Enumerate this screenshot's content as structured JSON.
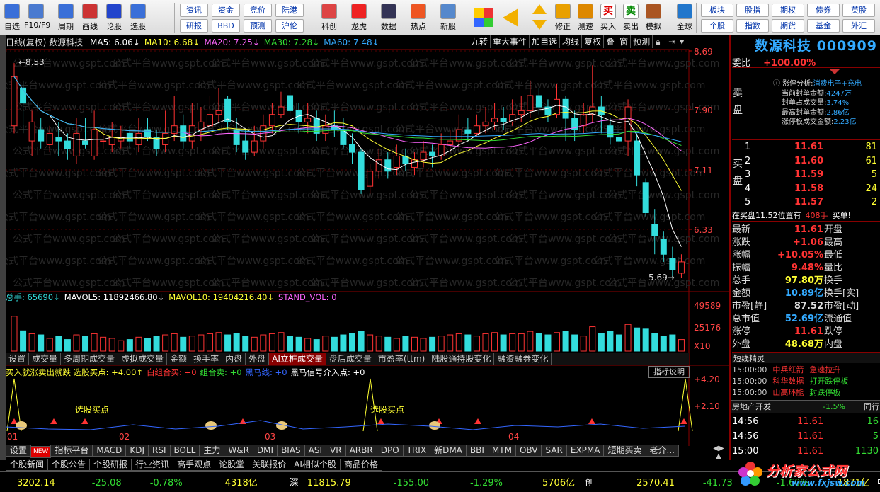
{
  "toolbar": {
    "buttons": [
      {
        "label": "自选",
        "icon": "star-grid-icon"
      },
      {
        "label": "F10/F9",
        "icon": "document-icon"
      },
      {
        "label": "周期",
        "icon": "clock-icon"
      },
      {
        "label": "画线",
        "icon": "pencil-icon"
      },
      {
        "label": "论股",
        "icon": "chat-icon"
      },
      {
        "label": "选股",
        "icon": "magnifier-chart-icon"
      }
    ],
    "grid": [
      "资讯",
      "资金",
      "竞价",
      "陆港",
      "研报",
      "BBD",
      "预测",
      "沪伦"
    ],
    "buttons2": [
      {
        "label": "科创",
        "icon": "chart-icon"
      },
      {
        "label": "龙虎",
        "icon": "dragon-icon"
      },
      {
        "label": "数据",
        "icon": "pe-icon"
      },
      {
        "label": "热点",
        "icon": "flame-icon"
      },
      {
        "label": "新股",
        "icon": "ipo-icon"
      }
    ],
    "buttons3": [
      {
        "label": "修正",
        "icon": "undo-icon"
      },
      {
        "label": "测速",
        "icon": "stopwatch-icon"
      },
      {
        "label": "买入",
        "icon": "buy-icon",
        "glyph": "买"
      },
      {
        "label": "卖出",
        "icon": "sell-icon",
        "glyph": "卖"
      },
      {
        "label": "模拟",
        "icon": "hammer-icon"
      },
      {
        "label": "全球",
        "icon": "globe-icon"
      }
    ],
    "grid2": [
      "板块",
      "股指",
      "期权",
      "债券",
      "英股",
      "个股",
      "指数",
      "期货",
      "基金",
      "外汇"
    ]
  },
  "chart": {
    "title_line": "日线(复权) 数源科技",
    "ma": [
      {
        "label": "MA5: 6.06↓",
        "color": "#ffffff"
      },
      {
        "label": "MA10: 6.68↓",
        "color": "#ffff33"
      },
      {
        "label": "MA20: 7.25↓",
        "color": "#ff66ff"
      },
      {
        "label": "MA30: 7.28↓",
        "color": "#33dd33"
      },
      {
        "label": "MA60: 7.48↓",
        "color": "#33aaff"
      }
    ],
    "top_buttons": [
      "九转",
      "重大事件",
      "加自选",
      "均线",
      "复权",
      "叠",
      "窗",
      "预测"
    ],
    "price_ticks": [
      "8.69",
      "7.90",
      "7.11",
      "6.33"
    ],
    "high_label": "8.53",
    "low_label": "5.69",
    "watermark": "公式平台www.gspt.com",
    "vol_line": {
      "parts": [
        {
          "t": "总手: 65690↓",
          "c": "#33dddd"
        },
        {
          "t": "MAVOL5: 11892466.80↓",
          "c": "#ffffff"
        },
        {
          "t": "MAVOL10: 19404216.40↓",
          "c": "#ffff33"
        },
        {
          "t": "STAND_VOL: 0",
          "c": "#ff66ff"
        }
      ]
    },
    "vol_ticks": [
      "49589",
      "25176",
      "X10"
    ],
    "vol_tabs": [
      "设置",
      "成交量",
      "多周期成交量",
      "虚拟成交量",
      "金额",
      "换手率",
      "内盘",
      "外盘",
      "AI立桩成交量",
      "盘后成交量",
      "市盈率(ttm)",
      "陆股通持股变化",
      "融资融券变化"
    ],
    "vol_tab_active": "AI立桩成交量",
    "ind_line": {
      "parts": [
        {
          "t": "买入就涨卖出就跌 选股买点: +4.00↑",
          "c": "#ffff33"
        },
        {
          "t": "白组合买: +0",
          "c": "#ff3333"
        },
        {
          "t": "组合卖: +0",
          "c": "#33dd33"
        },
        {
          "t": "黑马线: +0",
          "c": "#3366ff"
        },
        {
          "t": "黑马信号介入点: +0",
          "c": "#ffffff"
        }
      ]
    },
    "ind_button": "指标说明",
    "ind_ticks": [
      "+4.20",
      "+2.10"
    ],
    "ind_annots": [
      "选股买点",
      "选股买点"
    ],
    "date_labels": [
      "01",
      "02",
      "03",
      "04"
    ],
    "bottom_tabs": [
      "设置",
      "NEW",
      "指标平台",
      "MACD",
      "KDJ",
      "RSI",
      "BOLL",
      "主力",
      "W&R",
      "DMI",
      "BIAS",
      "ASI",
      "VR",
      "ARBR",
      "DPO",
      "TRIX",
      "新DMA",
      "BBI",
      "MTM",
      "OBV",
      "SAR",
      "EXPMA",
      "短期买卖",
      "老介..."
    ],
    "news_tabs": [
      "个股新闻",
      "个股公告",
      "个股研报",
      "行业资讯",
      "高手观点",
      "论股堂",
      "关联报价",
      "AI相似个股",
      "商品价格"
    ]
  },
  "quote": {
    "name": "数源科技",
    "code": "000909",
    "weibi_label": "委比",
    "weibi": "+100.00%",
    "sell_label": "卖盘",
    "buy_label": "买盘",
    "limit_analysis": {
      "title": "涨停分析:",
      "tag": "消费电子+充电",
      "rows": [
        [
          "当前封单金额:",
          "4247万"
        ],
        [
          "封单占成交量:",
          "3.74%"
        ],
        [
          "最高封单金额:",
          "2.86亿"
        ],
        [
          "涨停板成交金额:",
          "2.23亿"
        ]
      ]
    },
    "bids": [
      [
        "1",
        "11.61",
        "81"
      ],
      [
        "2",
        "11.60",
        "61"
      ],
      [
        "3",
        "11.59",
        "5"
      ],
      [
        "4",
        "11.58",
        "24"
      ],
      [
        "5",
        "11.57",
        "2"
      ]
    ],
    "bid_note": [
      "在买盘11.52位置有",
      "408手",
      "买单!"
    ],
    "stats": [
      [
        "最新",
        "11.61",
        "开盘",
        ""
      ],
      [
        "涨跌",
        "+1.06",
        "最高",
        ""
      ],
      [
        "涨幅",
        "+10.05%",
        "最低",
        ""
      ],
      [
        "振幅",
        "9.48%",
        "量比",
        ""
      ],
      [
        "总手",
        "97.80万",
        "换手",
        ""
      ],
      [
        "金额",
        "10.89亿",
        "换手[实]",
        ""
      ],
      [
        "市盈[静]",
        "87.52",
        "市盈[动]",
        ""
      ],
      [
        "总市值",
        "52.69亿",
        "流通值",
        ""
      ],
      [
        "涨停",
        "11.61",
        "跌停",
        ""
      ],
      [
        "外盘",
        "48.68万",
        "内盘",
        ""
      ]
    ],
    "sprite_title": "短线精灵",
    "sprite": [
      [
        "15:00:00",
        "中兵红箭",
        "急速拉升"
      ],
      [
        "15:00:00",
        "科华数据",
        "打开跌停板"
      ],
      [
        "15:00:00",
        "山高环能",
        "封跌停板"
      ]
    ],
    "sector": [
      "房地产开发",
      "-1.5%",
      "同行"
    ],
    "ticks": [
      [
        "14:56",
        "11.61",
        "16"
      ],
      [
        "14:56",
        "11.61",
        "5"
      ],
      [
        "15:00",
        "11.61",
        "1130"
      ]
    ]
  },
  "status": {
    "items": [
      {
        "t": "3202.14",
        "c": "#ffff33"
      },
      {
        "t": "-25.08",
        "c": "#33dd33"
      },
      {
        "t": "-0.78%",
        "c": "#33dd33"
      },
      {
        "t": "4318亿",
        "c": "#ffff33"
      },
      {
        "t": "深",
        "c": "#ffffff"
      },
      {
        "t": "11815.79",
        "c": "#ffff33"
      },
      {
        "t": "-155.00",
        "c": "#33dd33"
      },
      {
        "t": "-1.29%",
        "c": "#33dd33"
      },
      {
        "t": "5706亿",
        "c": "#ffff33"
      },
      {
        "t": "创",
        "c": "#ffffff"
      },
      {
        "t": "2570.41",
        "c": "#ffff33"
      },
      {
        "t": "-41.73",
        "c": "#33dd33"
      },
      {
        "t": "-1.60%",
        "c": "#33dd33"
      },
      {
        "t": "1871亿",
        "c": "#ffff33"
      },
      {
        "t": "中小",
        "c": "#ffffff"
      }
    ],
    "logo": "分析家公式网",
    "logo_url": "www.fxjsw.com"
  }
}
